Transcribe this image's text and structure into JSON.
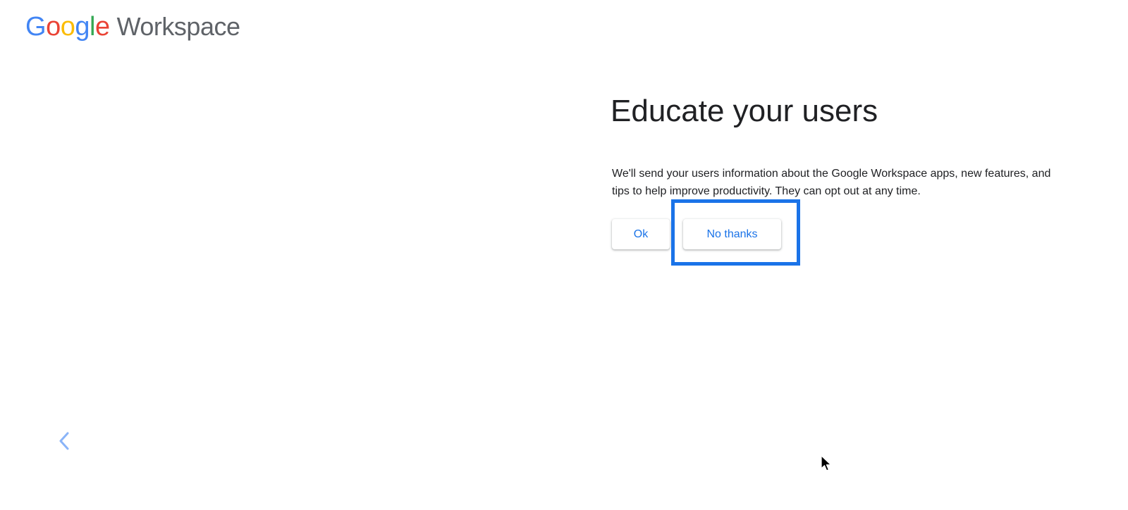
{
  "header": {
    "logo_letters": [
      {
        "char": "G",
        "color": "#4285F4"
      },
      {
        "char": "o",
        "color": "#EA4335"
      },
      {
        "char": "o",
        "color": "#FBBC05"
      },
      {
        "char": "g",
        "color": "#4285F4"
      },
      {
        "char": "l",
        "color": "#34A853"
      },
      {
        "char": "e",
        "color": "#EA4335"
      }
    ],
    "product_name": "Workspace"
  },
  "main": {
    "title": "Educate your users",
    "description": "We'll send your users information about the Google Workspace apps, new features, and tips to help improve productivity. They can opt out at any time.",
    "ok_label": "Ok",
    "no_thanks_label": "No thanks"
  },
  "navigation": {
    "back_icon": "chevron-left-icon"
  },
  "colors": {
    "accent": "#1a73e8",
    "highlight_border": "#1a73e8",
    "text_primary": "#202124",
    "text_secondary": "#5f6368"
  }
}
